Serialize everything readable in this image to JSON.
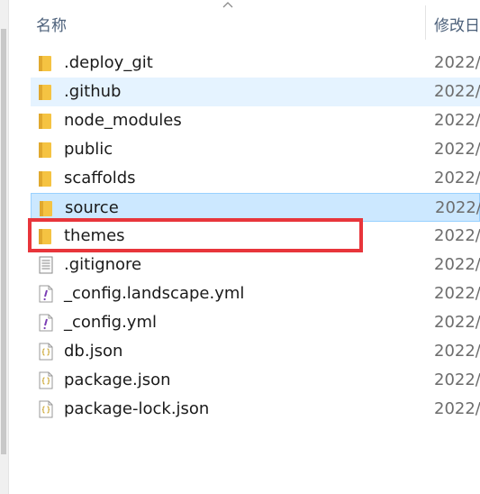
{
  "header": {
    "name_label": "名称",
    "date_label": "修改日"
  },
  "files": [
    {
      "name": ".deploy_git",
      "type": "folder",
      "date": "2022/",
      "state": "normal"
    },
    {
      "name": ".github",
      "type": "folder",
      "date": "2022/",
      "state": "hover"
    },
    {
      "name": "node_modules",
      "type": "folder",
      "date": "2022/",
      "state": "normal"
    },
    {
      "name": "public",
      "type": "folder",
      "date": "2022/",
      "state": "normal"
    },
    {
      "name": "scaffolds",
      "type": "folder",
      "date": "2022/",
      "state": "normal"
    },
    {
      "name": "source",
      "type": "folder",
      "date": "2022/",
      "state": "selected"
    },
    {
      "name": "themes",
      "type": "folder",
      "date": "2022/",
      "state": "normal"
    },
    {
      "name": ".gitignore",
      "type": "text-file",
      "date": "2022/",
      "state": "normal"
    },
    {
      "name": "_config.landscape.yml",
      "type": "yml-file",
      "date": "2022/",
      "state": "normal"
    },
    {
      "name": "_config.yml",
      "type": "yml-file",
      "date": "2022/",
      "state": "normal"
    },
    {
      "name": "db.json",
      "type": "json-file",
      "date": "2022/",
      "state": "normal"
    },
    {
      "name": "package.json",
      "type": "json-file",
      "date": "2022/",
      "state": "normal"
    },
    {
      "name": "package-lock.json",
      "type": "json-file",
      "date": "2022/",
      "state": "normal"
    }
  ],
  "highlight": {
    "target": "themes",
    "color": "#e8353b"
  },
  "colors": {
    "hover": "#e5f3ff",
    "selected": "#cce8ff",
    "folder": "#f5c342"
  }
}
